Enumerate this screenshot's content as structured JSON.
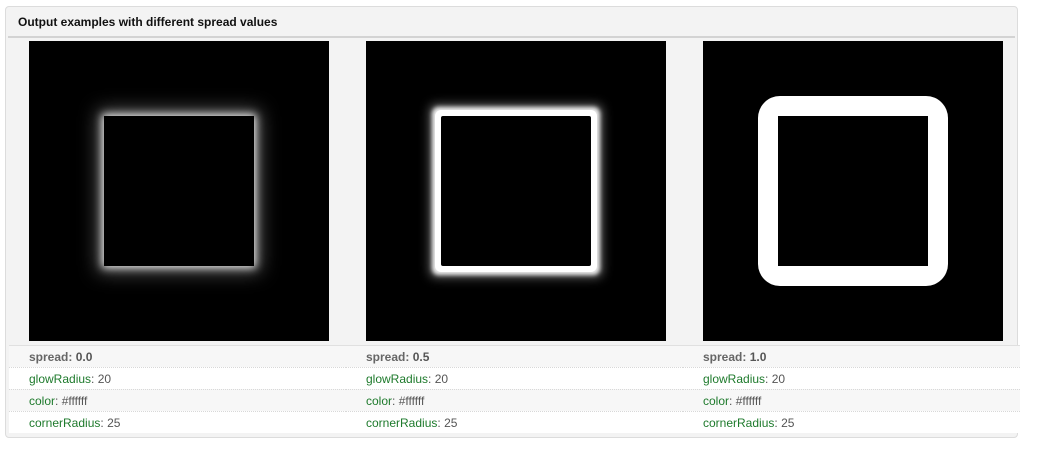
{
  "panel": {
    "title": "Output examples with different spread values"
  },
  "examples": [
    {
      "spread_label": "spread:",
      "spread_value": "0.0",
      "glowRadius_label": "glowRadius",
      "glowRadius_value": "20",
      "color_label": "color",
      "color_value": "#ffffff",
      "cornerRadius_label": "cornerRadius",
      "cornerRadius_value": "25"
    },
    {
      "spread_label": "spread:",
      "spread_value": "0.5",
      "glowRadius_label": "glowRadius",
      "glowRadius_value": "20",
      "color_label": "color",
      "color_value": "#ffffff",
      "cornerRadius_label": "cornerRadius",
      "cornerRadius_value": "25"
    },
    {
      "spread_label": "spread:",
      "spread_value": "1.0",
      "glowRadius_label": "glowRadius",
      "glowRadius_value": "20",
      "color_label": "color",
      "color_value": "#ffffff",
      "cornerRadius_label": "cornerRadius",
      "cornerRadius_value": "25"
    }
  ],
  "colors": {
    "property_key": "#1e7a2c",
    "preview_background": "#000000",
    "glow": "#ffffff"
  }
}
